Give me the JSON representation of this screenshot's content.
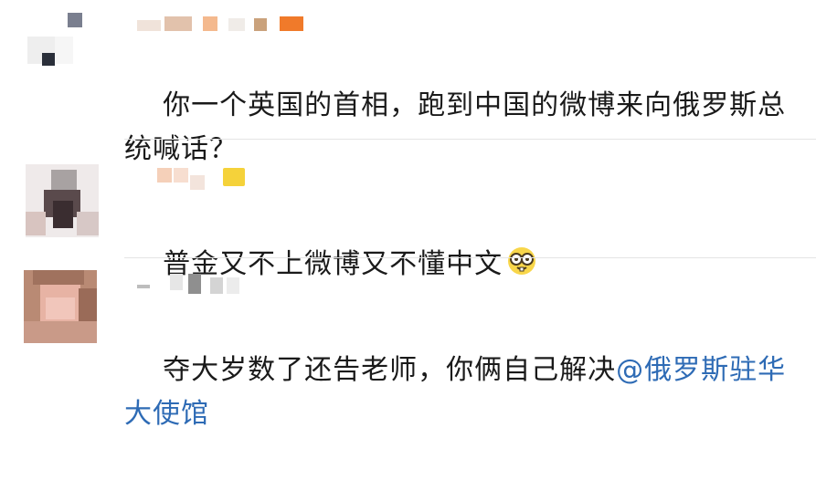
{
  "comments": [
    {
      "text": "你一个英国的首相，跑到中国的微博来向俄罗斯总统喊话？",
      "name_color": "#e8c9b3",
      "badge_color": "#f07a2a"
    },
    {
      "text": "普金又不上微博又不懂中文",
      "emoji": "nerd-glasses-emoji",
      "badge_color": "#f5d23a"
    },
    {
      "text": "夺大岁数了还告老师，你俩自己解决",
      "mention": "@俄罗斯驻华大使馆"
    }
  ],
  "colors": {
    "mention": "#2e6bb5",
    "text": "#1a1a1a",
    "divider": "#e4e4e4"
  }
}
